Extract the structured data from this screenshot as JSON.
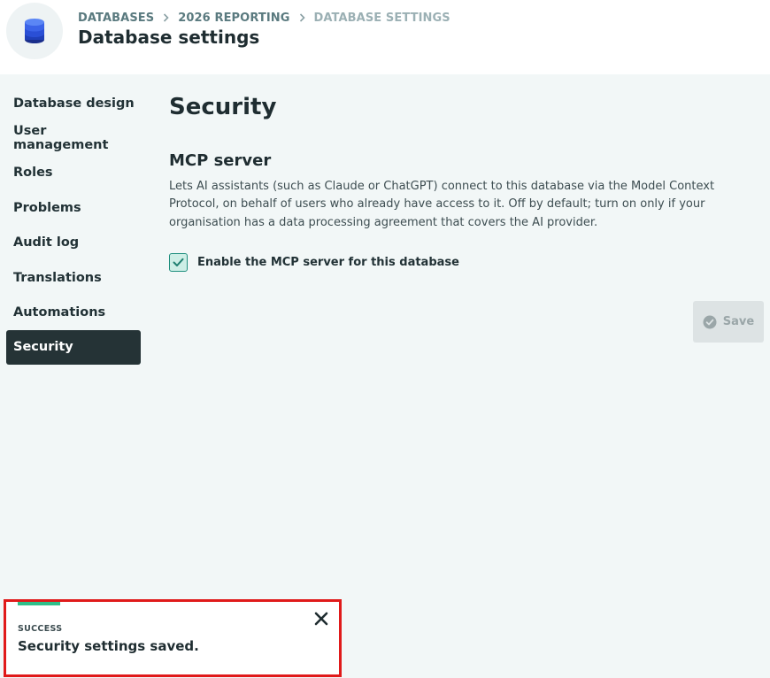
{
  "header": {
    "breadcrumb": [
      "DATABASES",
      "2026 REPORTING",
      "DATABASE SETTINGS"
    ],
    "title": "Database settings",
    "icon": "database-icon"
  },
  "sidebar": {
    "items": [
      {
        "label": "Database design",
        "active": false
      },
      {
        "label": "User management",
        "active": false
      },
      {
        "label": "Roles",
        "active": false
      },
      {
        "label": "Problems",
        "active": false
      },
      {
        "label": "Audit log",
        "active": false
      },
      {
        "label": "Translations",
        "active": false
      },
      {
        "label": "Automations",
        "active": false
      },
      {
        "label": "Security",
        "active": true
      }
    ]
  },
  "main": {
    "section_title": "Security",
    "mcp": {
      "title": "MCP server",
      "description": "Lets AI assistants (such as Claude or ChatGPT) connect to this database via the Model Context Protocol, on behalf of users who already have access to it. Off by default; turn on only if your organisation has a data processing agreement that covers the AI provider.",
      "checkbox_label": "Enable the MCP server for this database",
      "checked": true
    },
    "save_label": "Save"
  },
  "toast": {
    "kind": "SUCCESS",
    "message": "Security settings saved.",
    "accent_color": "#2fbf8a"
  },
  "colors": {
    "active_nav_bg": "#253336",
    "page_bg": "#f2f7f7",
    "checkbox_border": "#1f8f7e",
    "toast_highlight": "#e01a1a"
  }
}
